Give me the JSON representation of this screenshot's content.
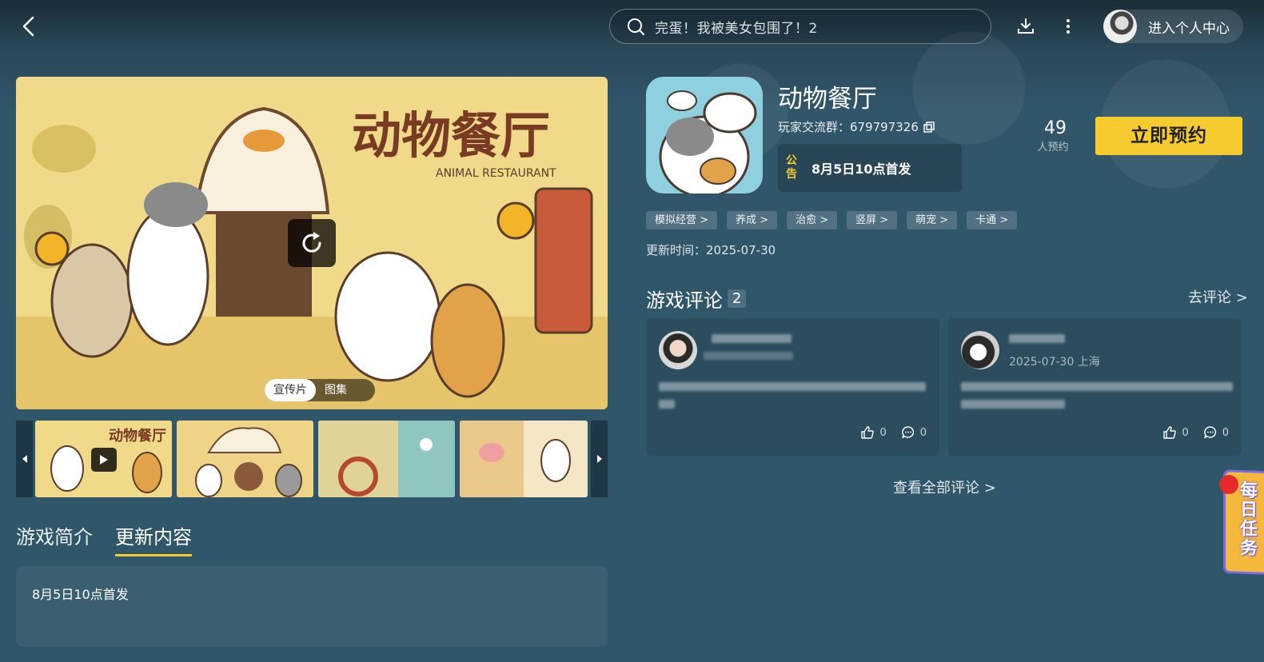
{
  "header": {
    "search_placeholder": "完蛋！我被美女包围了！2",
    "user_center_label": "进入个人中心"
  },
  "media": {
    "toggle_trailer": "宣传片",
    "toggle_gallery": "图集"
  },
  "game": {
    "title": "动物餐厅",
    "player_group": "玩家交流群：679797326",
    "notice_tag": "公告",
    "notice_text": "8月5日10点首发",
    "reserve_count": "49",
    "reserve_count_label": "人预约",
    "reserve_button": "立即预约",
    "tags": [
      "模拟经营 >",
      "养成 >",
      "治愈 >",
      "竖屏 >",
      "萌宠 >",
      "卡通 >"
    ],
    "update_time": "更新时间：2025-07-30"
  },
  "tabs": [
    {
      "label": "游戏简介",
      "active": false
    },
    {
      "label": "更新内容",
      "active": true
    }
  ],
  "intro": {
    "text": "8月5日10点首发"
  },
  "reviews": {
    "heading": "游戏评论",
    "count": "2",
    "go_review": "去评论 >",
    "items": [
      {
        "meta": "",
        "likes": "0",
        "comments": "0"
      },
      {
        "meta": "2025-07-30 上海",
        "likes": "0",
        "comments": "0"
      }
    ],
    "see_all": "查看全部评论 >"
  },
  "daily_task": {
    "label": "每日任务"
  },
  "colors": {
    "accent": "#f5cb2f",
    "background": "#2f5468"
  }
}
